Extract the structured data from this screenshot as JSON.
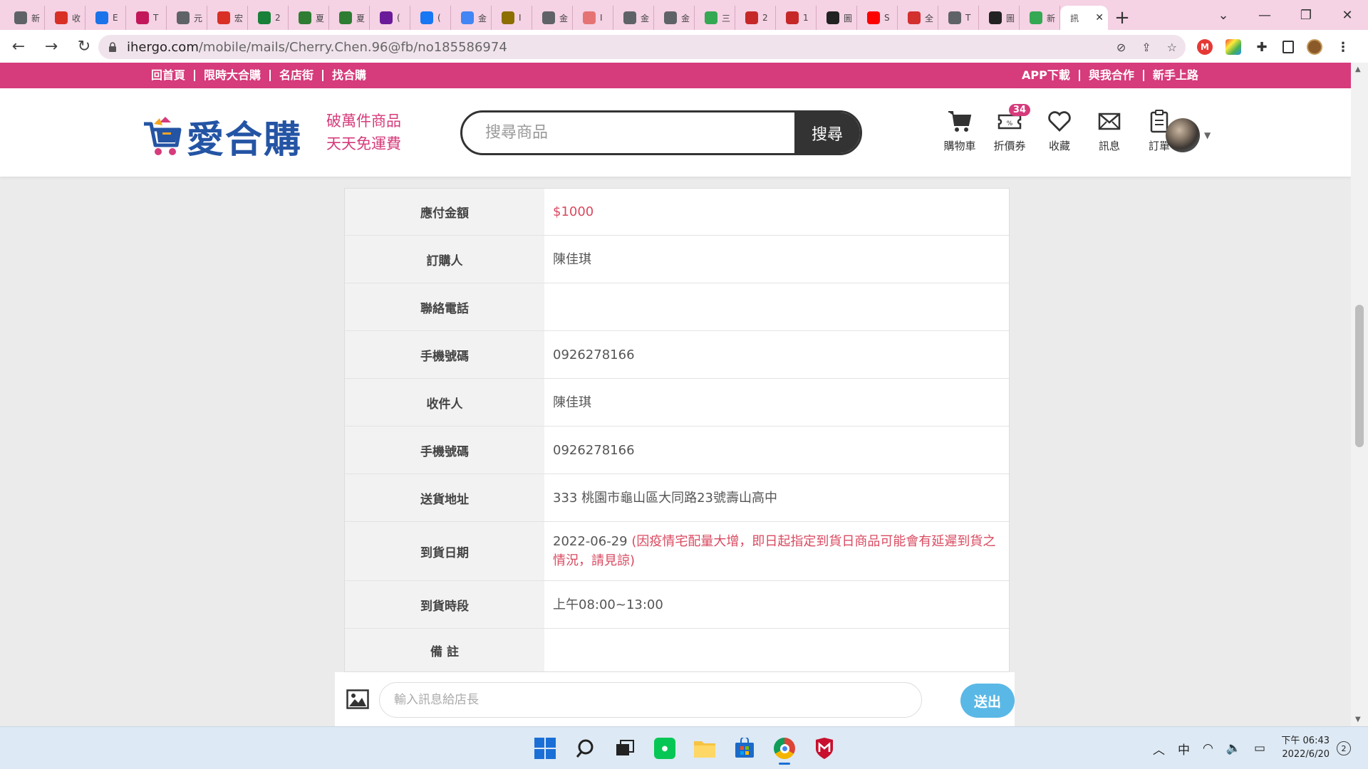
{
  "browser": {
    "tabs": [
      {
        "title": "新",
        "icon": "chrome-icon",
        "color": "#5f6368"
      },
      {
        "title": "收",
        "icon": "gmail-icon",
        "color": "#d93025"
      },
      {
        "title": "E",
        "icon": "web-icon",
        "color": "#1a73e8"
      },
      {
        "title": "T",
        "icon": "web-icon",
        "color": "#c2185b"
      },
      {
        "title": "元",
        "icon": "globe-icon",
        "color": "#5f6368"
      },
      {
        "title": "宏",
        "icon": "gmail-icon",
        "color": "#d93025"
      },
      {
        "title": "2",
        "icon": "sheets-icon",
        "color": "#188038"
      },
      {
        "title": "夏",
        "icon": "web-icon",
        "color": "#2e7d32"
      },
      {
        "title": "夏",
        "icon": "web-icon",
        "color": "#2e7d32"
      },
      {
        "title": "(",
        "icon": "mail-icon",
        "color": "#6a1b9a"
      },
      {
        "title": "(",
        "icon": "facebook-icon",
        "color": "#1877f2"
      },
      {
        "title": "金",
        "icon": "google-icon",
        "color": "#4285f4"
      },
      {
        "title": "I",
        "icon": "web-icon",
        "color": "#8d6e00"
      },
      {
        "title": "金",
        "icon": "globe-icon",
        "color": "#5f6368"
      },
      {
        "title": "I",
        "icon": "web-icon",
        "color": "#e57373"
      },
      {
        "title": "金",
        "icon": "globe-icon",
        "color": "#5f6368"
      },
      {
        "title": "金",
        "icon": "globe-icon",
        "color": "#5f6368"
      },
      {
        "title": "三",
        "icon": "maps-icon",
        "color": "#34a853"
      },
      {
        "title": "2",
        "icon": "web-icon",
        "color": "#c62828"
      },
      {
        "title": "1",
        "icon": "web-icon",
        "color": "#c62828"
      },
      {
        "title": "圖",
        "icon": "web-icon",
        "color": "#222222"
      },
      {
        "title": "S",
        "icon": "youtube-icon",
        "color": "#ff0000"
      },
      {
        "title": "全",
        "icon": "web-icon",
        "color": "#d32f2f"
      },
      {
        "title": "T",
        "icon": "globe-icon",
        "color": "#5f6368"
      },
      {
        "title": "圖",
        "icon": "web-icon",
        "color": "#222222"
      },
      {
        "title": "新",
        "icon": "maps-icon",
        "color": "#34a853"
      }
    ],
    "active_tab_title": "訊",
    "url_domain": "ihergo.com",
    "url_path": "/mobile/mails/Cherry.Chen.96@fb/no185586974"
  },
  "site": {
    "topbar_left": [
      "回首頁",
      "限時大合購",
      "名店街",
      "找合購"
    ],
    "topbar_right": [
      "APP下載",
      "與我合作",
      "新手上路"
    ],
    "logo_text": "愛合購",
    "slogan_line1": "破萬件商品",
    "slogan_line2": "天天免運費",
    "search_placeholder": "搜尋商品",
    "search_button": "搜尋",
    "header_icons": [
      {
        "label": "購物車",
        "icon": "cart-icon"
      },
      {
        "label": "折價券",
        "icon": "coupon-icon",
        "badge": "34"
      },
      {
        "label": "收藏",
        "icon": "heart-icon"
      },
      {
        "label": "訊息",
        "icon": "mail-icon"
      },
      {
        "label": "訂單",
        "icon": "clipboard-icon"
      }
    ],
    "brand_color": "#d63b7b",
    "logo_color": "#2454a4"
  },
  "order": {
    "rows": [
      {
        "label": "應付金額",
        "value": "$1000"
      },
      {
        "label": "訂購人",
        "value": "陳佳琪"
      },
      {
        "label": "聯絡電話",
        "value": ""
      },
      {
        "label": "手機號碼",
        "value": "0926278166"
      },
      {
        "label": "收件人",
        "value": "陳佳琪"
      },
      {
        "label": "手機號碼",
        "value": "0926278166"
      },
      {
        "label": "送貨地址",
        "value": "333 桃園市龜山區大同路23號壽山高中"
      },
      {
        "label": "到貨日期",
        "value": "2022-06-29",
        "notice": "(因疫情宅配量大增，即日起指定到貨日商品可能會有延遲到貨之情況，請見諒)"
      },
      {
        "label": "到貨時段",
        "value": "上午08:00~13:00"
      },
      {
        "label": "備 註",
        "value": ""
      }
    ]
  },
  "message": {
    "placeholder": "輸入訊息給店長",
    "send_label": "送出"
  },
  "taskbar": {
    "ime": "中",
    "time": "下午 06:43",
    "date": "2022/6/20",
    "notifications": "2"
  }
}
